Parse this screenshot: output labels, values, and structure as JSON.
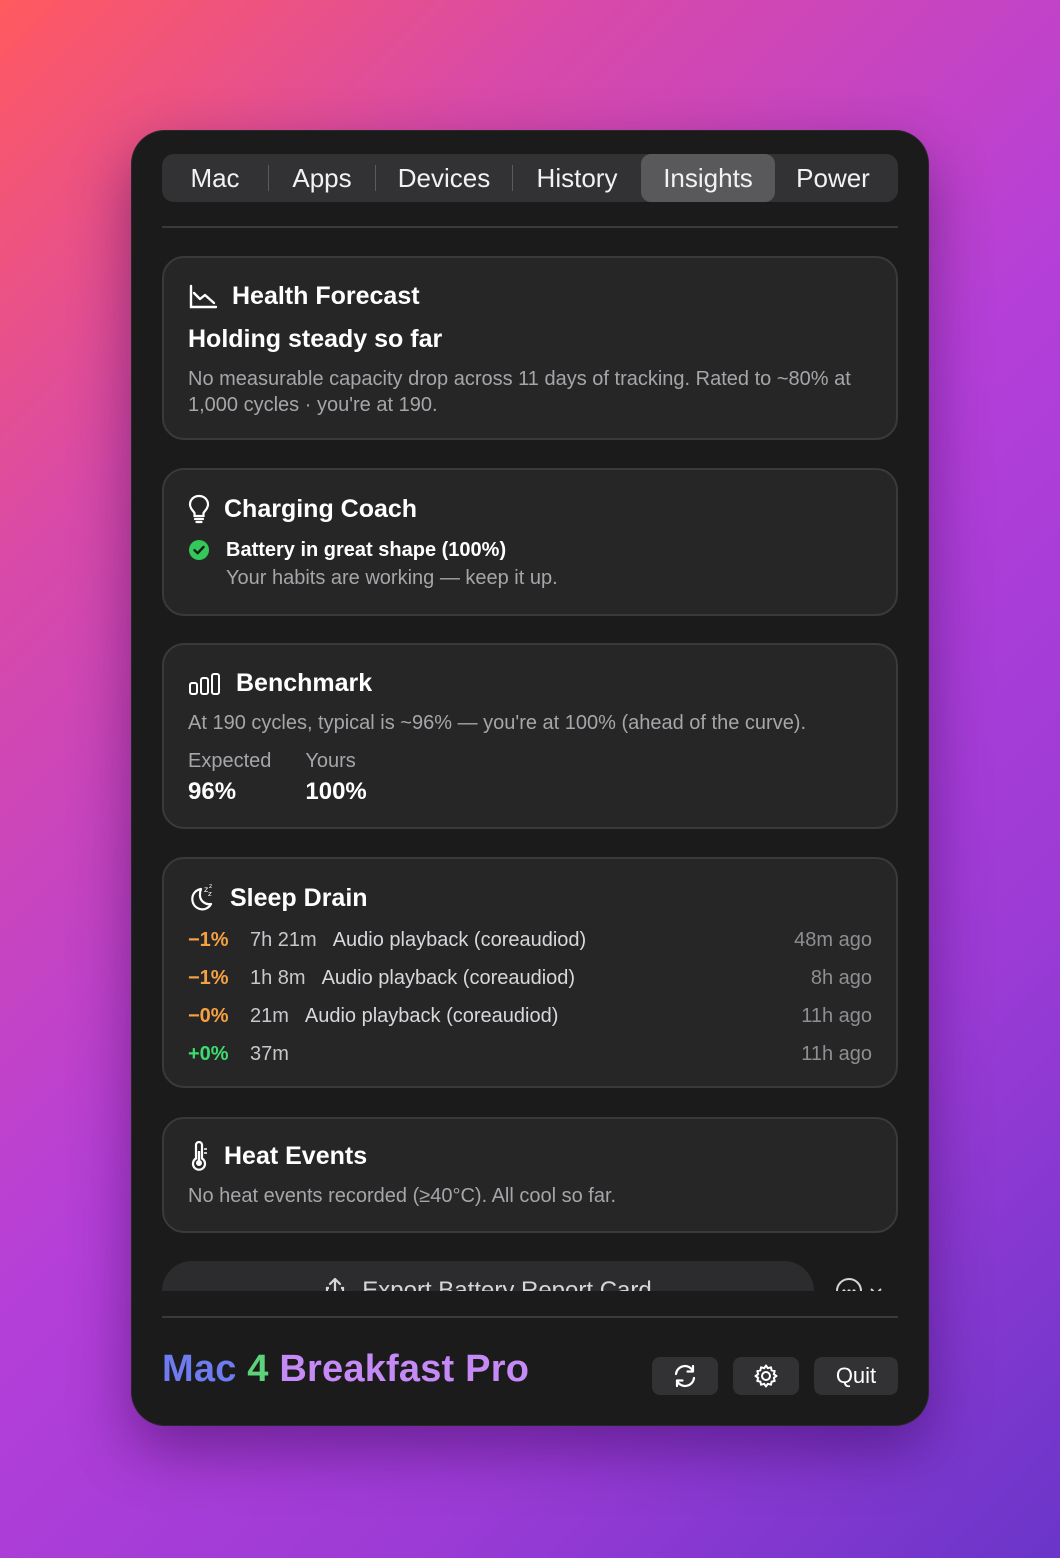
{
  "tabs": [
    {
      "label": "Mac"
    },
    {
      "label": "Apps"
    },
    {
      "label": "Devices"
    },
    {
      "label": "History"
    },
    {
      "label": "Insights",
      "active": true
    },
    {
      "label": "Power"
    }
  ],
  "health": {
    "title": "Health Forecast",
    "headline": "Holding steady so far",
    "body": "No measurable capacity drop across 11 days of tracking. Rated to ~80% at 1,000 cycles · you're at 190."
  },
  "coach": {
    "title": "Charging Coach",
    "status": "Battery in great shape (100%)",
    "note": "Your habits are working — keep it up."
  },
  "benchmark": {
    "title": "Benchmark",
    "body": "At 190 cycles, typical is ~96% — you're at 100% (ahead of the curve).",
    "expected_label": "Expected",
    "expected_value": "96%",
    "yours_label": "Yours",
    "yours_value": "100%"
  },
  "sleep": {
    "title": "Sleep Drain",
    "rows": [
      {
        "pct": "−1%",
        "duration": "7h 21m",
        "app": "Audio playback (coreaudiod)",
        "ago": "48m ago",
        "color": "#f5a142"
      },
      {
        "pct": "−1%",
        "duration": "1h 8m",
        "app": "Audio playback (coreaudiod)",
        "ago": "8h ago",
        "color": "#f5a142"
      },
      {
        "pct": "−0%",
        "duration": "21m",
        "app": "Audio playback (coreaudiod)",
        "ago": "11h ago",
        "color": "#f5a142"
      },
      {
        "pct": "+0%",
        "duration": "37m",
        "app": "",
        "ago": "11h ago",
        "color": "#3ddc6e"
      }
    ]
  },
  "heat": {
    "title": "Heat Events",
    "body": "No heat events recorded (≥40°C). All cool so far."
  },
  "export": {
    "label": "Export Battery Report Card"
  },
  "footer": {
    "brand_part1": "Mac",
    "brand_part2": "4",
    "brand_part3": "Breakfast Pro",
    "quit_label": "Quit"
  },
  "colors": {
    "panel": "#1b1b1c",
    "card": "#262627",
    "success": "#34c759",
    "drain": "#f5a142",
    "gain": "#3ddc6e",
    "brand_blue": "#6e7cf0",
    "brand_green": "#5ed27a",
    "brand_purple": "#c58af5"
  }
}
